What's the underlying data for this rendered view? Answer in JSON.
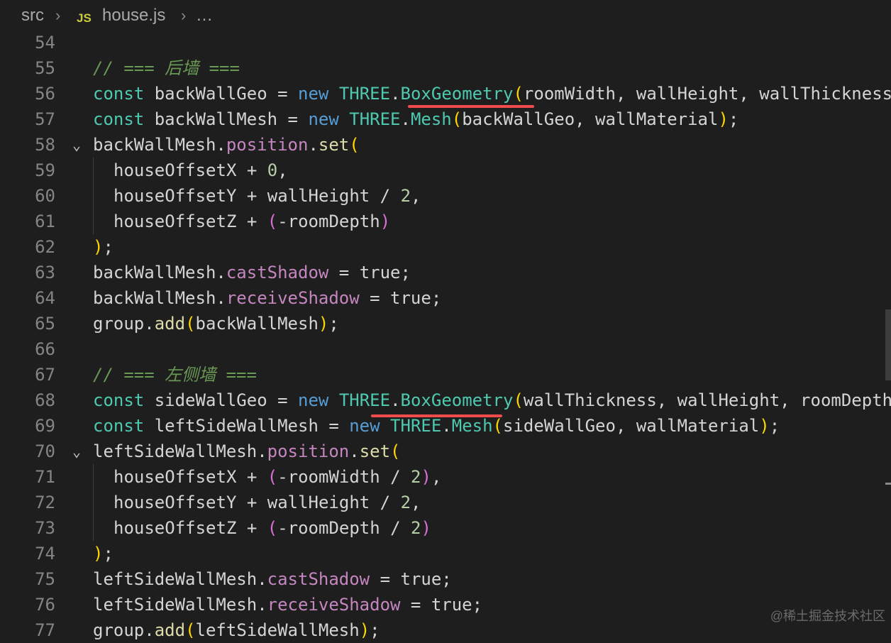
{
  "breadcrumb": {
    "folder": "src",
    "file_icon": "JS",
    "file": "house.js",
    "tail": "…",
    "separator": "›"
  },
  "editor": {
    "lines": [
      {
        "n": "54",
        "fold": false,
        "indent": 0,
        "tokens": []
      },
      {
        "n": "55",
        "fold": false,
        "indent": 0,
        "tokens": [
          {
            "t": "comment",
            "v": "// === 后墙 ==="
          }
        ]
      },
      {
        "n": "56",
        "fold": false,
        "indent": 0,
        "tokens": [
          {
            "t": "const",
            "v": "const"
          },
          {
            "t": "var",
            "v": " backWallGeo = "
          },
          {
            "t": "kw",
            "v": "new"
          },
          {
            "t": "var",
            "v": " "
          },
          {
            "t": "class",
            "v": "THREE"
          },
          {
            "t": "var",
            "v": "."
          },
          {
            "t": "class",
            "v": "BoxGeometry"
          },
          {
            "t": "paren1",
            "v": "("
          },
          {
            "t": "var",
            "v": "roomWidth, wallHeight, wallThickness"
          }
        ]
      },
      {
        "n": "57",
        "fold": false,
        "indent": 0,
        "tokens": [
          {
            "t": "const",
            "v": "const"
          },
          {
            "t": "var",
            "v": " backWallMesh = "
          },
          {
            "t": "kw",
            "v": "new"
          },
          {
            "t": "var",
            "v": " "
          },
          {
            "t": "class",
            "v": "THREE"
          },
          {
            "t": "var",
            "v": "."
          },
          {
            "t": "class",
            "v": "Mesh"
          },
          {
            "t": "paren1",
            "v": "("
          },
          {
            "t": "var",
            "v": "backWallGeo, wallMaterial"
          },
          {
            "t": "paren1",
            "v": ")"
          },
          {
            "t": "var",
            "v": ";"
          }
        ]
      },
      {
        "n": "58",
        "fold": true,
        "indent": 0,
        "tokens": [
          {
            "t": "var",
            "v": "backWallMesh."
          },
          {
            "t": "prop",
            "v": "position"
          },
          {
            "t": "var",
            "v": "."
          },
          {
            "t": "method",
            "v": "set"
          },
          {
            "t": "paren1",
            "v": "("
          }
        ]
      },
      {
        "n": "59",
        "fold": false,
        "indent": 1,
        "tokens": [
          {
            "t": "var",
            "v": "houseOffsetX + "
          },
          {
            "t": "num",
            "v": "0"
          },
          {
            "t": "var",
            "v": ","
          }
        ]
      },
      {
        "n": "60",
        "fold": false,
        "indent": 1,
        "tokens": [
          {
            "t": "var",
            "v": "houseOffsetY + wallHeight / "
          },
          {
            "t": "num",
            "v": "2"
          },
          {
            "t": "var",
            "v": ","
          }
        ]
      },
      {
        "n": "61",
        "fold": false,
        "indent": 1,
        "tokens": [
          {
            "t": "var",
            "v": "houseOffsetZ + "
          },
          {
            "t": "paren2",
            "v": "("
          },
          {
            "t": "var",
            "v": "-roomDepth"
          },
          {
            "t": "paren2",
            "v": ")"
          }
        ]
      },
      {
        "n": "62",
        "fold": false,
        "indent": 0,
        "tokens": [
          {
            "t": "paren1",
            "v": ")"
          },
          {
            "t": "var",
            "v": ";"
          }
        ]
      },
      {
        "n": "63",
        "fold": false,
        "indent": 0,
        "tokens": [
          {
            "t": "var",
            "v": "backWallMesh."
          },
          {
            "t": "prop",
            "v": "castShadow"
          },
          {
            "t": "var",
            "v": " = true;"
          }
        ]
      },
      {
        "n": "64",
        "fold": false,
        "indent": 0,
        "tokens": [
          {
            "t": "var",
            "v": "backWallMesh."
          },
          {
            "t": "prop",
            "v": "receiveShadow"
          },
          {
            "t": "var",
            "v": " = true;"
          }
        ]
      },
      {
        "n": "65",
        "fold": false,
        "indent": 0,
        "tokens": [
          {
            "t": "var",
            "v": "group."
          },
          {
            "t": "method",
            "v": "add"
          },
          {
            "t": "paren1",
            "v": "("
          },
          {
            "t": "var",
            "v": "backWallMesh"
          },
          {
            "t": "paren1",
            "v": ")"
          },
          {
            "t": "var",
            "v": ";"
          }
        ]
      },
      {
        "n": "66",
        "fold": false,
        "indent": 0,
        "tokens": []
      },
      {
        "n": "67",
        "fold": false,
        "indent": 0,
        "tokens": [
          {
            "t": "comment",
            "v": "// === 左侧墙 ==="
          }
        ]
      },
      {
        "n": "68",
        "fold": false,
        "indent": 0,
        "tokens": [
          {
            "t": "const",
            "v": "const"
          },
          {
            "t": "var",
            "v": " sideWallGeo = "
          },
          {
            "t": "kw",
            "v": "new"
          },
          {
            "t": "var",
            "v": " "
          },
          {
            "t": "class",
            "v": "THREE"
          },
          {
            "t": "var",
            "v": "."
          },
          {
            "t": "class",
            "v": "BoxGeometry"
          },
          {
            "t": "paren1",
            "v": "("
          },
          {
            "t": "var",
            "v": "wallThickness, wallHeight, roomDepth"
          }
        ]
      },
      {
        "n": "69",
        "fold": false,
        "indent": 0,
        "tokens": [
          {
            "t": "const",
            "v": "const"
          },
          {
            "t": "var",
            "v": " leftSideWallMesh = "
          },
          {
            "t": "kw",
            "v": "new"
          },
          {
            "t": "var",
            "v": " "
          },
          {
            "t": "class",
            "v": "THREE"
          },
          {
            "t": "var",
            "v": "."
          },
          {
            "t": "class",
            "v": "Mesh"
          },
          {
            "t": "paren1",
            "v": "("
          },
          {
            "t": "var",
            "v": "sideWallGeo, wallMaterial"
          },
          {
            "t": "paren1",
            "v": ")"
          },
          {
            "t": "var",
            "v": ";"
          }
        ]
      },
      {
        "n": "70",
        "fold": true,
        "indent": 0,
        "tokens": [
          {
            "t": "var",
            "v": "leftSideWallMesh."
          },
          {
            "t": "prop",
            "v": "position"
          },
          {
            "t": "var",
            "v": "."
          },
          {
            "t": "method",
            "v": "set"
          },
          {
            "t": "paren1",
            "v": "("
          }
        ]
      },
      {
        "n": "71",
        "fold": false,
        "indent": 1,
        "tokens": [
          {
            "t": "var",
            "v": "houseOffsetX + "
          },
          {
            "t": "paren2",
            "v": "("
          },
          {
            "t": "var",
            "v": "-roomWidth / "
          },
          {
            "t": "num",
            "v": "2"
          },
          {
            "t": "paren2",
            "v": ")"
          },
          {
            "t": "var",
            "v": ","
          }
        ]
      },
      {
        "n": "72",
        "fold": false,
        "indent": 1,
        "tokens": [
          {
            "t": "var",
            "v": "houseOffsetY + wallHeight / "
          },
          {
            "t": "num",
            "v": "2"
          },
          {
            "t": "var",
            "v": ","
          }
        ]
      },
      {
        "n": "73",
        "fold": false,
        "indent": 1,
        "tokens": [
          {
            "t": "var",
            "v": "houseOffsetZ + "
          },
          {
            "t": "paren2",
            "v": "("
          },
          {
            "t": "var",
            "v": "-roomDepth / "
          },
          {
            "t": "num",
            "v": "2"
          },
          {
            "t": "paren2",
            "v": ")"
          }
        ]
      },
      {
        "n": "74",
        "fold": false,
        "indent": 0,
        "tokens": [
          {
            "t": "paren1",
            "v": ")"
          },
          {
            "t": "var",
            "v": ";"
          }
        ]
      },
      {
        "n": "75",
        "fold": false,
        "indent": 0,
        "tokens": [
          {
            "t": "var",
            "v": "leftSideWallMesh."
          },
          {
            "t": "prop",
            "v": "castShadow"
          },
          {
            "t": "var",
            "v": " = true;"
          }
        ]
      },
      {
        "n": "76",
        "fold": false,
        "indent": 0,
        "tokens": [
          {
            "t": "var",
            "v": "leftSideWallMesh."
          },
          {
            "t": "prop",
            "v": "receiveShadow"
          },
          {
            "t": "var",
            "v": " = true;"
          }
        ]
      },
      {
        "n": "77",
        "fold": false,
        "indent": 0,
        "tokens": [
          {
            "t": "var",
            "v": "group."
          },
          {
            "t": "method",
            "v": "add"
          },
          {
            "t": "paren1",
            "v": "("
          },
          {
            "t": "var",
            "v": "leftSideWallMesh"
          },
          {
            "t": "paren1",
            "v": ")"
          },
          {
            "t": "var",
            "v": ";"
          }
        ]
      }
    ]
  },
  "colors": {
    "background": "#1e1e1e",
    "underline": "#f14c4c"
  },
  "watermark": "@稀土掘金技术社区"
}
